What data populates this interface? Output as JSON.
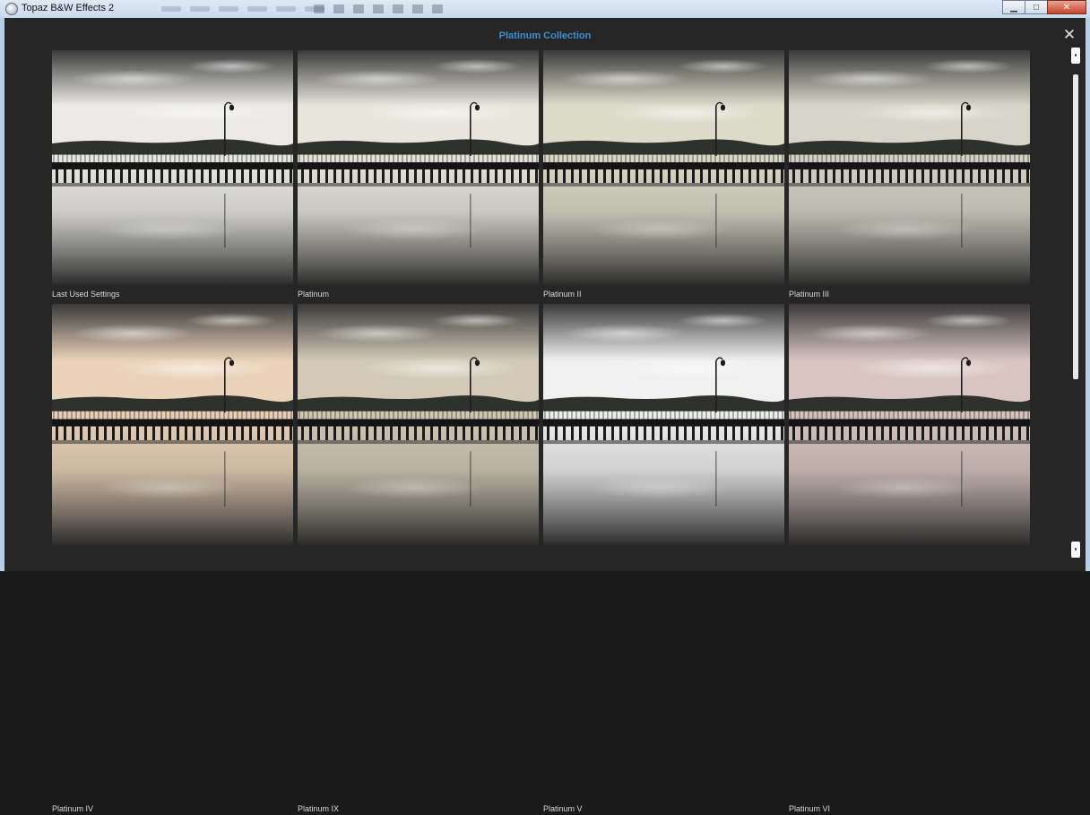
{
  "window": {
    "title": "Topaz B&W Effects 2",
    "controls": {
      "minimize": "▁",
      "maximize": "□",
      "close": "✕"
    }
  },
  "dialog": {
    "title": "Platinum Collection",
    "close_glyph": "✕",
    "accent_color": "#3b8fd0"
  },
  "presets": [
    {
      "label": "Last Used Settings",
      "tone": "#ebeae6"
    },
    {
      "label": "Platinum",
      "tone": "#e7e5dc"
    },
    {
      "label": "Platinum II",
      "tone": "#dcdac9"
    },
    {
      "label": "Platinum III",
      "tone": "#d7d5c8"
    },
    {
      "label": "Platinum IV",
      "tone": "#ead2b8"
    },
    {
      "label": "Platinum IX",
      "tone": "#d2cab7"
    },
    {
      "label": "Platinum V",
      "tone": "#f0f0f0"
    },
    {
      "label": "Platinum VI",
      "tone": "#d8c5c1"
    }
  ]
}
